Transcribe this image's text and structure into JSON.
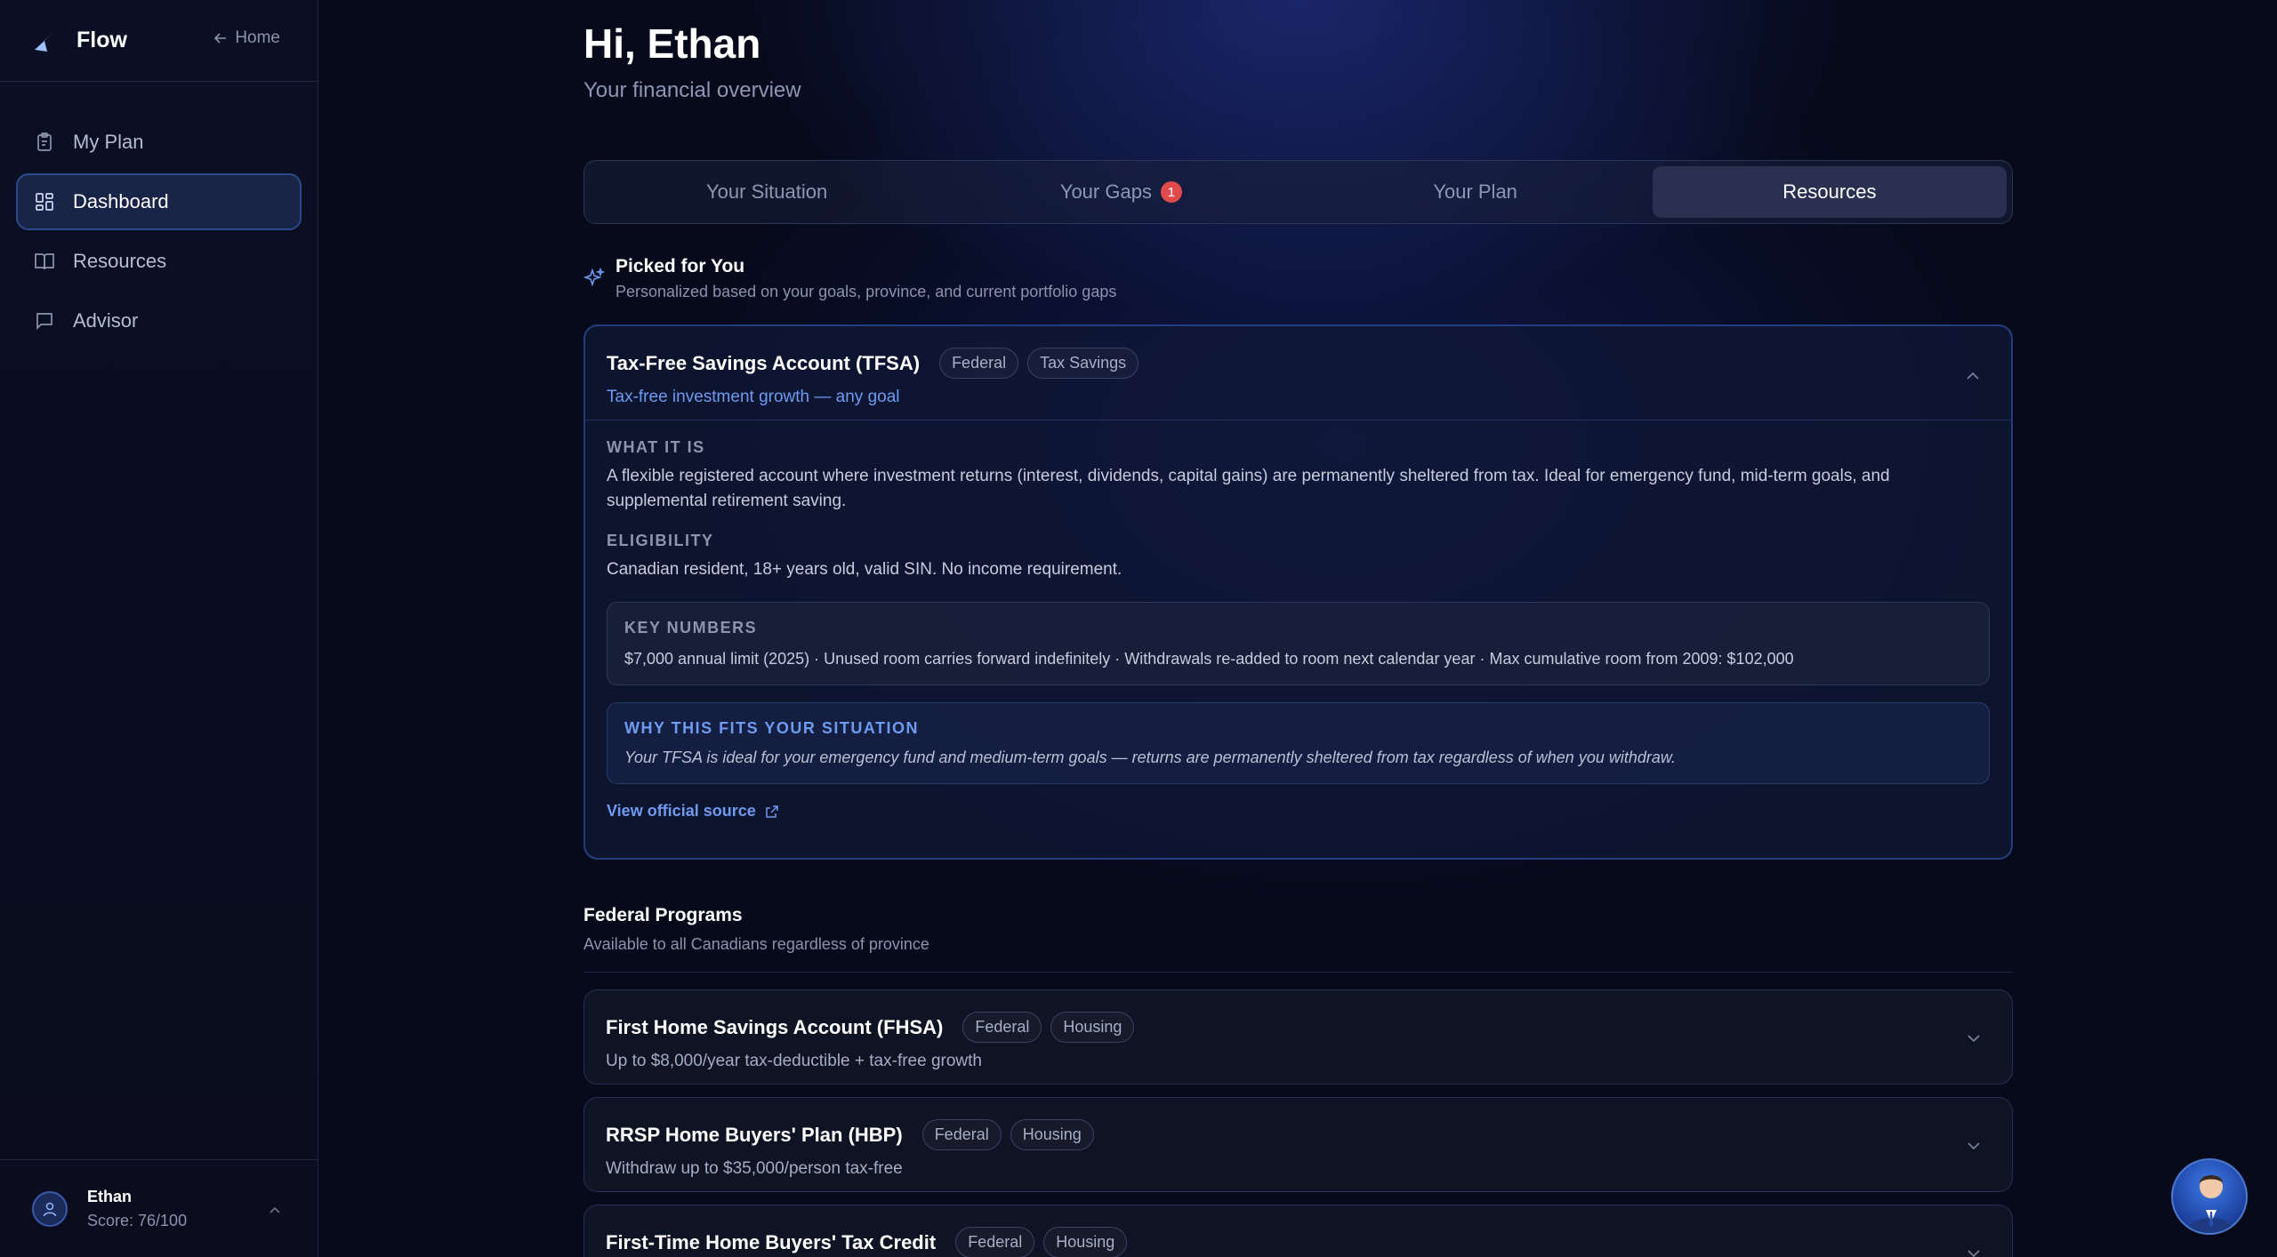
{
  "app": {
    "name": "Flow",
    "home_label": "Home"
  },
  "sidebar": {
    "items": [
      {
        "label": "My Plan",
        "icon": "clipboard-icon",
        "active": false
      },
      {
        "label": "Dashboard",
        "icon": "dashboard-grid-icon",
        "active": true
      },
      {
        "label": "Resources",
        "icon": "book-icon",
        "active": false
      },
      {
        "label": "Advisor",
        "icon": "chat-icon",
        "active": false
      }
    ],
    "user": {
      "name": "Ethan",
      "score": "Score: 76/100"
    }
  },
  "header": {
    "greeting": "Hi, Ethan",
    "subtitle": "Your financial overview"
  },
  "tabs": [
    {
      "label": "Your Situation",
      "active": false
    },
    {
      "label": "Your Gaps",
      "badge": "1",
      "active": false
    },
    {
      "label": "Your Plan",
      "active": false
    },
    {
      "label": "Resources",
      "active": true
    }
  ],
  "picked": {
    "title": "Picked for You",
    "subtitle": "Personalized based on your goals, province, and current portfolio gaps"
  },
  "featured": {
    "title": "Tax-Free Savings Account (TFSA)",
    "tags": [
      "Federal",
      "Tax Savings"
    ],
    "tagline": "Tax-free investment growth — any goal",
    "what_label": "WHAT IT IS",
    "what_text": "A flexible registered account where investment returns (interest, dividends, capital gains) are permanently sheltered from tax. Ideal for emergency fund, mid-term goals, and supplemental retirement saving.",
    "elig_label": "ELIGIBILITY",
    "elig_text": "Canadian resident, 18+ years old, valid SIN. No income requirement.",
    "key_label": "KEY NUMBERS",
    "key_text": "$7,000 annual limit (2025) · Unused room carries forward indefinitely · Withdrawals re-added to room next calendar year · Max cumulative room from 2009: $102,000",
    "why_label": "WHY THIS FITS YOUR SITUATION",
    "why_text": "Your TFSA is ideal for your emergency fund and medium-term goals — returns are permanently sheltered from tax regardless of when you withdraw.",
    "source_label": "View official source"
  },
  "federal": {
    "title": "Federal Programs",
    "subtitle": "Available to all Canadians regardless of province",
    "programs": [
      {
        "title": "First Home Savings Account (FHSA)",
        "tags": [
          "Federal",
          "Housing"
        ],
        "subtitle": "Up to $8,000/year tax-deductible + tax-free growth"
      },
      {
        "title": "RRSP Home Buyers' Plan (HBP)",
        "tags": [
          "Federal",
          "Housing"
        ],
        "subtitle": "Withdraw up to $35,000/person tax-free"
      },
      {
        "title": "First-Time Home Buyers' Tax Credit",
        "tags": [
          "Federal",
          "Housing"
        ],
        "subtitle": ""
      }
    ]
  },
  "colors": {
    "accent": "#6e9af0",
    "badge": "#e04a4a",
    "active_nav": "#182448"
  }
}
